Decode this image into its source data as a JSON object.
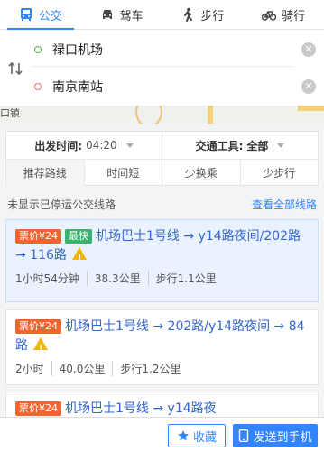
{
  "modes": [
    {
      "label": "公交",
      "icon": "bus-icon",
      "active": true
    },
    {
      "label": "驾车",
      "icon": "car-icon",
      "active": false
    },
    {
      "label": "步行",
      "icon": "walk-icon",
      "active": false
    },
    {
      "label": "骑行",
      "icon": "bike-icon",
      "active": false
    }
  ],
  "route": {
    "origin": "禄口机场",
    "destination": "南京南站"
  },
  "map": {
    "town_label": "口镇"
  },
  "filters": {
    "depart_label": "出发时间:",
    "depart_value": "04:20",
    "vehicle_label": "交通工具:",
    "vehicle_value": "全部",
    "tabs": [
      "推荐路线",
      "时间短",
      "少换乘",
      "少步行"
    ],
    "active_tab": 0
  },
  "notice": {
    "message": "未显示已停运公交线路",
    "link": "查看全部线路"
  },
  "routes": [
    {
      "price": "票价¥24",
      "tag": "最快",
      "title": "机场巴士1号线 → y14路夜间/202路 → 116路",
      "time": "1小时54分钟",
      "distance": "38.3公里",
      "walk": "步行1.1公里"
    },
    {
      "price": "票价¥24",
      "title": "机场巴士1号线 → 202路/y14路夜间 → 84路",
      "time": "2小时",
      "distance": "40.0公里",
      "walk": "步行1.2公里"
    },
    {
      "price": "票价¥24",
      "title": "机场巴士1号线 → y14路夜"
    }
  ],
  "bottom": {
    "fav_label": "收藏",
    "send_label": "发送到手机"
  },
  "colors": {
    "accent": "#3385ff",
    "price": "#f0652f",
    "fast": "#3ab26e",
    "warning": "#f5b400"
  }
}
